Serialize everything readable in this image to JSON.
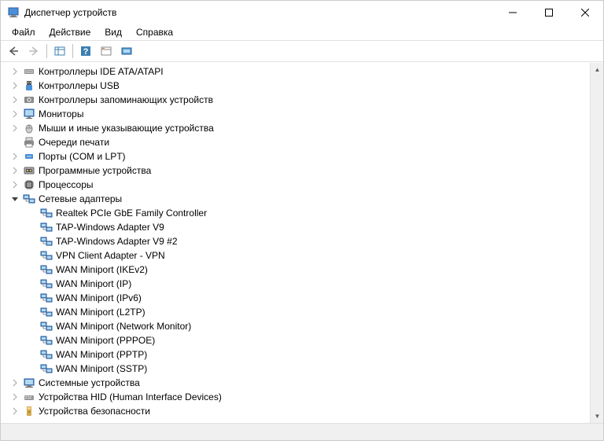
{
  "window": {
    "title": "Диспетчер устройств"
  },
  "menu": {
    "file": "Файл",
    "action": "Действие",
    "view": "Вид",
    "help": "Справка"
  },
  "tree": {
    "items": [
      {
        "label": "Контроллеры IDE ATA/ATAPI",
        "icon": "ide",
        "expanded": false,
        "hasChildren": true,
        "indent": 0
      },
      {
        "label": "Контроллеры USB",
        "icon": "usb",
        "expanded": false,
        "hasChildren": true,
        "indent": 0
      },
      {
        "label": "Контроллеры запоминающих устройств",
        "icon": "storage",
        "expanded": false,
        "hasChildren": true,
        "indent": 0
      },
      {
        "label": "Мониторы",
        "icon": "monitor",
        "expanded": false,
        "hasChildren": true,
        "indent": 0
      },
      {
        "label": "Мыши и иные указывающие устройства",
        "icon": "mouse",
        "expanded": false,
        "hasChildren": true,
        "indent": 0
      },
      {
        "label": "Очереди печати",
        "icon": "printer",
        "expanded": false,
        "hasChildren": false,
        "indent": 0
      },
      {
        "label": "Порты (COM и LPT)",
        "icon": "port",
        "expanded": false,
        "hasChildren": true,
        "indent": 0
      },
      {
        "label": "Программные устройства",
        "icon": "software",
        "expanded": false,
        "hasChildren": true,
        "indent": 0
      },
      {
        "label": "Процессоры",
        "icon": "cpu",
        "expanded": false,
        "hasChildren": true,
        "indent": 0
      },
      {
        "label": "Сетевые адаптеры",
        "icon": "network",
        "expanded": true,
        "hasChildren": true,
        "indent": 0
      },
      {
        "label": "Realtek PCIe GbE Family Controller",
        "icon": "network",
        "expanded": false,
        "hasChildren": false,
        "indent": 1
      },
      {
        "label": "TAP-Windows Adapter V9",
        "icon": "network",
        "expanded": false,
        "hasChildren": false,
        "indent": 1
      },
      {
        "label": "TAP-Windows Adapter V9 #2",
        "icon": "network",
        "expanded": false,
        "hasChildren": false,
        "indent": 1
      },
      {
        "label": "VPN Client Adapter - VPN",
        "icon": "network",
        "expanded": false,
        "hasChildren": false,
        "indent": 1
      },
      {
        "label": "WAN Miniport (IKEv2)",
        "icon": "network",
        "expanded": false,
        "hasChildren": false,
        "indent": 1
      },
      {
        "label": "WAN Miniport (IP)",
        "icon": "network",
        "expanded": false,
        "hasChildren": false,
        "indent": 1
      },
      {
        "label": "WAN Miniport (IPv6)",
        "icon": "network",
        "expanded": false,
        "hasChildren": false,
        "indent": 1
      },
      {
        "label": "WAN Miniport (L2TP)",
        "icon": "network",
        "expanded": false,
        "hasChildren": false,
        "indent": 1
      },
      {
        "label": "WAN Miniport (Network Monitor)",
        "icon": "network",
        "expanded": false,
        "hasChildren": false,
        "indent": 1
      },
      {
        "label": "WAN Miniport (PPPOE)",
        "icon": "network",
        "expanded": false,
        "hasChildren": false,
        "indent": 1
      },
      {
        "label": "WAN Miniport (PPTP)",
        "icon": "network",
        "expanded": false,
        "hasChildren": false,
        "indent": 1
      },
      {
        "label": "WAN Miniport (SSTP)",
        "icon": "network",
        "expanded": false,
        "hasChildren": false,
        "indent": 1
      },
      {
        "label": "Системные устройства",
        "icon": "system",
        "expanded": false,
        "hasChildren": true,
        "indent": 0
      },
      {
        "label": "Устройства HID (Human Interface Devices)",
        "icon": "hid",
        "expanded": false,
        "hasChildren": true,
        "indent": 0
      },
      {
        "label": "Устройства безопасности",
        "icon": "security",
        "expanded": false,
        "hasChildren": true,
        "indent": 0
      }
    ]
  }
}
